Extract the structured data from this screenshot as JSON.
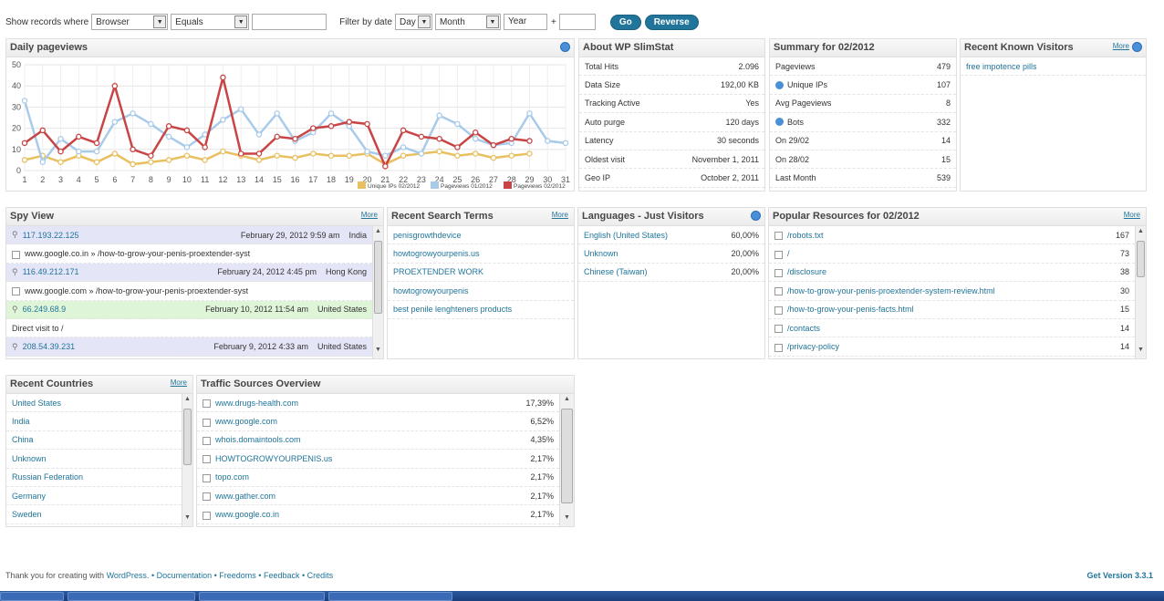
{
  "filters": {
    "show_label": "Show records where",
    "field": "Browser",
    "operator": "Equals",
    "value": "",
    "date_label": "Filter by date",
    "day": "Day",
    "month": "Month",
    "year": "Year",
    "plus": "+",
    "go": "Go",
    "reverse": "Reverse"
  },
  "daily": {
    "title": "Daily pageviews",
    "legend": [
      "Unique IPs 02/2012",
      "Pageviews 01/2012",
      "Pageviews 02/2012"
    ]
  },
  "chart_data": {
    "type": "line",
    "x": [
      1,
      2,
      3,
      4,
      5,
      6,
      7,
      8,
      9,
      10,
      11,
      12,
      13,
      14,
      15,
      16,
      17,
      18,
      19,
      20,
      21,
      22,
      23,
      24,
      25,
      26,
      27,
      28,
      29,
      30,
      31
    ],
    "ylim": [
      0,
      50
    ],
    "yticks": [
      0,
      10,
      20,
      30,
      40,
      50
    ],
    "grid": true,
    "legend_position": "bottom-right",
    "series": [
      {
        "name": "Unique IPs 02/2012",
        "color": "#e8c060",
        "values": [
          5,
          7,
          4,
          7,
          4,
          8,
          3,
          4,
          5,
          7,
          5,
          9,
          7,
          5,
          7,
          6,
          8,
          7,
          7,
          8,
          3,
          7,
          8,
          9,
          7,
          8,
          6,
          7,
          8,
          null,
          null
        ]
      },
      {
        "name": "Pageviews 01/2012",
        "color": "#a9cbea",
        "values": [
          33,
          4,
          15,
          9,
          9,
          23,
          27,
          22,
          16,
          11,
          17,
          24,
          29,
          17,
          27,
          14,
          18,
          27,
          21,
          9,
          7,
          11,
          8,
          26,
          22,
          15,
          12,
          13,
          27,
          14,
          13
        ]
      },
      {
        "name": "Pageviews 02/2012",
        "color": "#c94444",
        "values": [
          13,
          19,
          9,
          16,
          13,
          40,
          10,
          7,
          21,
          19,
          11,
          44,
          8,
          8,
          16,
          15,
          20,
          21,
          23,
          22,
          2,
          19,
          16,
          15,
          11,
          18,
          12,
          15,
          14,
          null,
          null
        ]
      }
    ]
  },
  "about": {
    "title": "About WP SlimStat",
    "rows": [
      {
        "k": "Total Hits",
        "v": "2.096"
      },
      {
        "k": "Data Size",
        "v": "192,00 KB"
      },
      {
        "k": "Tracking Active",
        "v": "Yes"
      },
      {
        "k": "Auto purge",
        "v": "120 days"
      },
      {
        "k": "Latency",
        "v": "30 seconds"
      },
      {
        "k": "Oldest visit",
        "v": "November 1, 2011"
      },
      {
        "k": "Geo IP",
        "v": "October 2, 2011"
      }
    ]
  },
  "summary": {
    "title": "Summary for 02/2012",
    "rows": [
      {
        "k": "Pageviews",
        "v": "479",
        "icon": false
      },
      {
        "k": "Unique IPs",
        "v": "107",
        "icon": true
      },
      {
        "k": "Avg Pageviews",
        "v": "8",
        "icon": false
      },
      {
        "k": "Bots",
        "v": "332",
        "icon": true
      },
      {
        "k": "On 29/02",
        "v": "14",
        "icon": false
      },
      {
        "k": "On 28/02",
        "v": "15",
        "icon": false
      },
      {
        "k": "Last Month",
        "v": "539",
        "icon": false
      }
    ]
  },
  "known": {
    "title": "Recent Known Visitors",
    "more": "More",
    "items": [
      "free impotence pills"
    ]
  },
  "spy": {
    "title": "Spy View",
    "more": "More",
    "rows": [
      {
        "type": "ip",
        "ip": "117.193.22.125",
        "date": "February 29, 2012 9:59 am",
        "country": "India",
        "green": false
      },
      {
        "type": "ref",
        "text": "www.google.co.in » /how-to-grow-your-penis-proextender-syst"
      },
      {
        "type": "ip",
        "ip": "116.49.212.171",
        "date": "February 24, 2012 4:45 pm",
        "country": "Hong Kong",
        "green": false
      },
      {
        "type": "ref",
        "text": "www.google.com » /how-to-grow-your-penis-proextender-syst"
      },
      {
        "type": "ip",
        "ip": "66.249.68.9",
        "date": "February 10, 2012 11:54 am",
        "country": "United States",
        "green": true
      },
      {
        "type": "plain",
        "text": "Direct visit to /"
      },
      {
        "type": "ip",
        "ip": "208.54.39.231",
        "date": "February 9, 2012 4:33 am",
        "country": "United States",
        "green": false
      }
    ]
  },
  "search": {
    "title": "Recent Search Terms",
    "more": "More",
    "items": [
      "penisgrowthdevice",
      "howtogrowyourpenis.us",
      "PROEXTENDER WORK",
      "howtogrowyourpenis",
      "best penile lenghteners products"
    ]
  },
  "languages": {
    "title": "Languages - Just Visitors",
    "rows": [
      {
        "k": "English (United States)",
        "v": "60,00%"
      },
      {
        "k": "Unknown",
        "v": "20,00%"
      },
      {
        "k": "Chinese (Taiwan)",
        "v": "20,00%"
      }
    ]
  },
  "popular": {
    "title": "Popular Resources for 02/2012",
    "more": "More",
    "rows": [
      {
        "k": "/robots.txt",
        "v": "167"
      },
      {
        "k": "/",
        "v": "73"
      },
      {
        "k": "/disclosure",
        "v": "38"
      },
      {
        "k": "/how-to-grow-your-penis-proextender-system-review.html",
        "v": "30"
      },
      {
        "k": "/how-to-grow-your-penis-facts.html",
        "v": "15"
      },
      {
        "k": "/contacts",
        "v": "14"
      },
      {
        "k": "/privacy-policy",
        "v": "14"
      }
    ]
  },
  "countries": {
    "title": "Recent Countries",
    "more": "More",
    "items": [
      "United States",
      "India",
      "China",
      "Unknown",
      "Russian Federation",
      "Germany",
      "Sweden"
    ]
  },
  "traffic": {
    "title": "Traffic Sources Overview",
    "rows": [
      {
        "k": "www.drugs-health.com",
        "v": "17,39%"
      },
      {
        "k": "www.google.com",
        "v": "6,52%"
      },
      {
        "k": "whois.domaintools.com",
        "v": "4,35%"
      },
      {
        "k": "HOWTOGROWYOURPENIS.us",
        "v": "2,17%"
      },
      {
        "k": "topo.com",
        "v": "2,17%"
      },
      {
        "k": "www.gather.com",
        "v": "2,17%"
      },
      {
        "k": "www.google.co.in",
        "v": "2,17%"
      }
    ]
  },
  "footer": {
    "thanks": "Thank you for creating with",
    "wordpress": "WordPress.",
    "links": "• Documentation • Freedoms • Feedback • Credits",
    "version": "Get Version 3.3.1"
  }
}
